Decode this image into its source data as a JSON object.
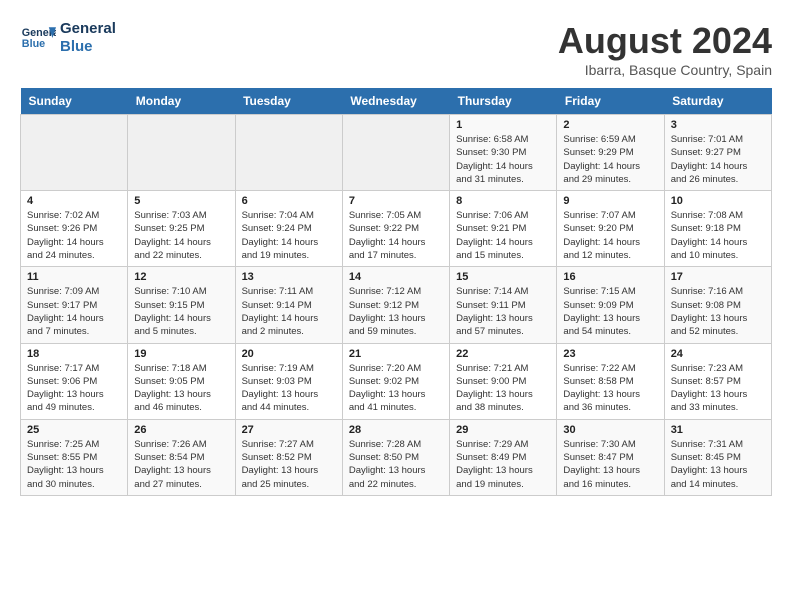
{
  "header": {
    "logo_line1": "General",
    "logo_line2": "Blue",
    "main_title": "August 2024",
    "subtitle": "Ibarra, Basque Country, Spain"
  },
  "weekdays": [
    "Sunday",
    "Monday",
    "Tuesday",
    "Wednesday",
    "Thursday",
    "Friday",
    "Saturday"
  ],
  "weeks": [
    [
      {
        "day": "",
        "info": ""
      },
      {
        "day": "",
        "info": ""
      },
      {
        "day": "",
        "info": ""
      },
      {
        "day": "",
        "info": ""
      },
      {
        "day": "1",
        "info": "Sunrise: 6:58 AM\nSunset: 9:30 PM\nDaylight: 14 hours\nand 31 minutes."
      },
      {
        "day": "2",
        "info": "Sunrise: 6:59 AM\nSunset: 9:29 PM\nDaylight: 14 hours\nand 29 minutes."
      },
      {
        "day": "3",
        "info": "Sunrise: 7:01 AM\nSunset: 9:27 PM\nDaylight: 14 hours\nand 26 minutes."
      }
    ],
    [
      {
        "day": "4",
        "info": "Sunrise: 7:02 AM\nSunset: 9:26 PM\nDaylight: 14 hours\nand 24 minutes."
      },
      {
        "day": "5",
        "info": "Sunrise: 7:03 AM\nSunset: 9:25 PM\nDaylight: 14 hours\nand 22 minutes."
      },
      {
        "day": "6",
        "info": "Sunrise: 7:04 AM\nSunset: 9:24 PM\nDaylight: 14 hours\nand 19 minutes."
      },
      {
        "day": "7",
        "info": "Sunrise: 7:05 AM\nSunset: 9:22 PM\nDaylight: 14 hours\nand 17 minutes."
      },
      {
        "day": "8",
        "info": "Sunrise: 7:06 AM\nSunset: 9:21 PM\nDaylight: 14 hours\nand 15 minutes."
      },
      {
        "day": "9",
        "info": "Sunrise: 7:07 AM\nSunset: 9:20 PM\nDaylight: 14 hours\nand 12 minutes."
      },
      {
        "day": "10",
        "info": "Sunrise: 7:08 AM\nSunset: 9:18 PM\nDaylight: 14 hours\nand 10 minutes."
      }
    ],
    [
      {
        "day": "11",
        "info": "Sunrise: 7:09 AM\nSunset: 9:17 PM\nDaylight: 14 hours\nand 7 minutes."
      },
      {
        "day": "12",
        "info": "Sunrise: 7:10 AM\nSunset: 9:15 PM\nDaylight: 14 hours\nand 5 minutes."
      },
      {
        "day": "13",
        "info": "Sunrise: 7:11 AM\nSunset: 9:14 PM\nDaylight: 14 hours\nand 2 minutes."
      },
      {
        "day": "14",
        "info": "Sunrise: 7:12 AM\nSunset: 9:12 PM\nDaylight: 13 hours\nand 59 minutes."
      },
      {
        "day": "15",
        "info": "Sunrise: 7:14 AM\nSunset: 9:11 PM\nDaylight: 13 hours\nand 57 minutes."
      },
      {
        "day": "16",
        "info": "Sunrise: 7:15 AM\nSunset: 9:09 PM\nDaylight: 13 hours\nand 54 minutes."
      },
      {
        "day": "17",
        "info": "Sunrise: 7:16 AM\nSunset: 9:08 PM\nDaylight: 13 hours\nand 52 minutes."
      }
    ],
    [
      {
        "day": "18",
        "info": "Sunrise: 7:17 AM\nSunset: 9:06 PM\nDaylight: 13 hours\nand 49 minutes."
      },
      {
        "day": "19",
        "info": "Sunrise: 7:18 AM\nSunset: 9:05 PM\nDaylight: 13 hours\nand 46 minutes."
      },
      {
        "day": "20",
        "info": "Sunrise: 7:19 AM\nSunset: 9:03 PM\nDaylight: 13 hours\nand 44 minutes."
      },
      {
        "day": "21",
        "info": "Sunrise: 7:20 AM\nSunset: 9:02 PM\nDaylight: 13 hours\nand 41 minutes."
      },
      {
        "day": "22",
        "info": "Sunrise: 7:21 AM\nSunset: 9:00 PM\nDaylight: 13 hours\nand 38 minutes."
      },
      {
        "day": "23",
        "info": "Sunrise: 7:22 AM\nSunset: 8:58 PM\nDaylight: 13 hours\nand 36 minutes."
      },
      {
        "day": "24",
        "info": "Sunrise: 7:23 AM\nSunset: 8:57 PM\nDaylight: 13 hours\nand 33 minutes."
      }
    ],
    [
      {
        "day": "25",
        "info": "Sunrise: 7:25 AM\nSunset: 8:55 PM\nDaylight: 13 hours\nand 30 minutes."
      },
      {
        "day": "26",
        "info": "Sunrise: 7:26 AM\nSunset: 8:54 PM\nDaylight: 13 hours\nand 27 minutes."
      },
      {
        "day": "27",
        "info": "Sunrise: 7:27 AM\nSunset: 8:52 PM\nDaylight: 13 hours\nand 25 minutes."
      },
      {
        "day": "28",
        "info": "Sunrise: 7:28 AM\nSunset: 8:50 PM\nDaylight: 13 hours\nand 22 minutes."
      },
      {
        "day": "29",
        "info": "Sunrise: 7:29 AM\nSunset: 8:49 PM\nDaylight: 13 hours\nand 19 minutes."
      },
      {
        "day": "30",
        "info": "Sunrise: 7:30 AM\nSunset: 8:47 PM\nDaylight: 13 hours\nand 16 minutes."
      },
      {
        "day": "31",
        "info": "Sunrise: 7:31 AM\nSunset: 8:45 PM\nDaylight: 13 hours\nand 14 minutes."
      }
    ]
  ]
}
